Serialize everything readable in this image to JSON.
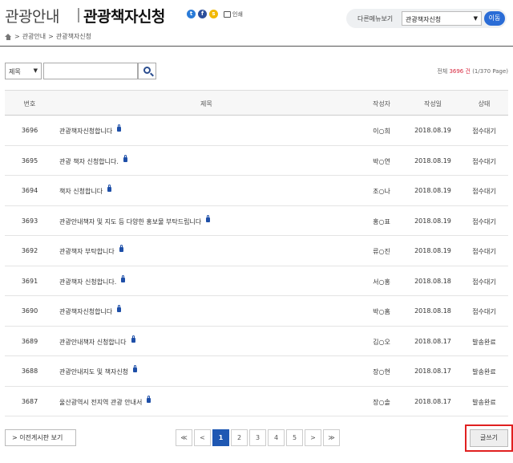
{
  "header": {
    "category": "관광안내",
    "title": "관광책자신청",
    "print_label": "인쇄"
  },
  "breadcrumb": [
    "관광안내",
    "관광책자신청"
  ],
  "other_menu": {
    "label": "다른메뉴보기",
    "selected": "관광책자신청",
    "go_label": "이동"
  },
  "search": {
    "field_selected": "제목",
    "query": "",
    "total_prefix": "전체",
    "total_count": "3696",
    "total_unit": "건",
    "page_info": "(1/370 Page)"
  },
  "table": {
    "headers": [
      "번호",
      "제목",
      "작성자",
      "작성일",
      "상태"
    ],
    "rows": [
      {
        "no": "3696",
        "title": "관광책자신청합니다",
        "author": "이○희",
        "date": "2018.08.19",
        "status": "접수대기"
      },
      {
        "no": "3695",
        "title": "관광 책자 신청합니다.",
        "author": "박○연",
        "date": "2018.08.19",
        "status": "접수대기"
      },
      {
        "no": "3694",
        "title": "책자 신청합니다",
        "author": "조○나",
        "date": "2018.08.19",
        "status": "접수대기"
      },
      {
        "no": "3693",
        "title": "관광안내책자 및 지도 등 다양한 홍보물 부탁드립니다",
        "author": "홍○표",
        "date": "2018.08.19",
        "status": "접수대기"
      },
      {
        "no": "3692",
        "title": "관광책자 부탁합니다",
        "author": "류○진",
        "date": "2018.08.19",
        "status": "접수대기"
      },
      {
        "no": "3691",
        "title": "관광책자 신청합니다.",
        "author": "서○홍",
        "date": "2018.08.18",
        "status": "접수대기"
      },
      {
        "no": "3690",
        "title": "관광책자신청합니다",
        "author": "박○홈",
        "date": "2018.08.18",
        "status": "접수대기"
      },
      {
        "no": "3689",
        "title": "관광안내책자 신청합니다",
        "author": "김○오",
        "date": "2018.08.17",
        "status": "발송완료"
      },
      {
        "no": "3688",
        "title": "관광안내지도 및 책자신청",
        "author": "장○현",
        "date": "2018.08.17",
        "status": "발송완료"
      },
      {
        "no": "3687",
        "title": "울산광역시 전지역 관광 안내서",
        "author": "장○솔",
        "date": "2018.08.17",
        "status": "발송완료"
      }
    ]
  },
  "pagination": {
    "first": "≪",
    "prev": "<",
    "pages": [
      "1",
      "2",
      "3",
      "4",
      "5"
    ],
    "current": "1",
    "next": ">",
    "last": "≫"
  },
  "buttons": {
    "prev_board": "> 이전게시판 보기",
    "write": "글쓰기"
  },
  "colors": {
    "accent": "#2a6cd6",
    "page_active": "#1f58b3",
    "total_highlight": "#d7263d",
    "write_highlight_border": "#e02020"
  }
}
